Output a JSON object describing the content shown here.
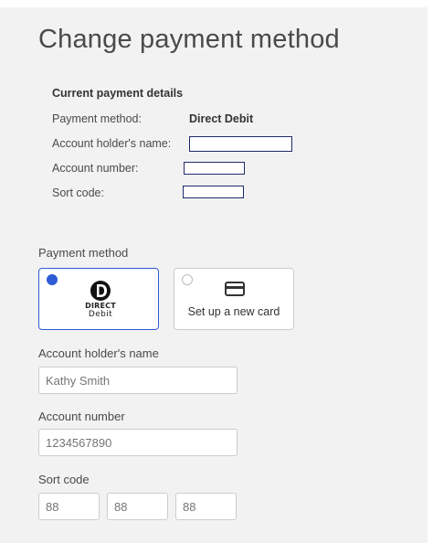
{
  "page": {
    "title": "Change payment method"
  },
  "current_details": {
    "heading": "Current payment details",
    "rows": [
      {
        "label": "Payment method:",
        "value": "Direct Debit"
      },
      {
        "label": "Account holder's name:",
        "value": ""
      },
      {
        "label": "Account number:",
        "value": ""
      },
      {
        "label": "Sort code:",
        "value": ""
      }
    ]
  },
  "payment_method": {
    "label": "Payment method",
    "options": [
      {
        "name": "Direct Debit",
        "logo_line1": "DIRECT",
        "logo_line2": "Debit",
        "selected": true
      },
      {
        "name": "Set up a new card",
        "icon": "credit-card-icon",
        "selected": false
      }
    ]
  },
  "form": {
    "holder_name": {
      "label": "Account holder's name",
      "placeholder": "Kathy Smith"
    },
    "account_number": {
      "label": "Account number",
      "placeholder": "1234567890"
    },
    "sort_code": {
      "label": "Sort code",
      "placeholders": [
        "88",
        "88",
        "88"
      ]
    }
  },
  "colors": {
    "accent": "#2f5bd4",
    "panel_bg": "#f2f2f2",
    "redaction_border": "#1f2c6b"
  }
}
